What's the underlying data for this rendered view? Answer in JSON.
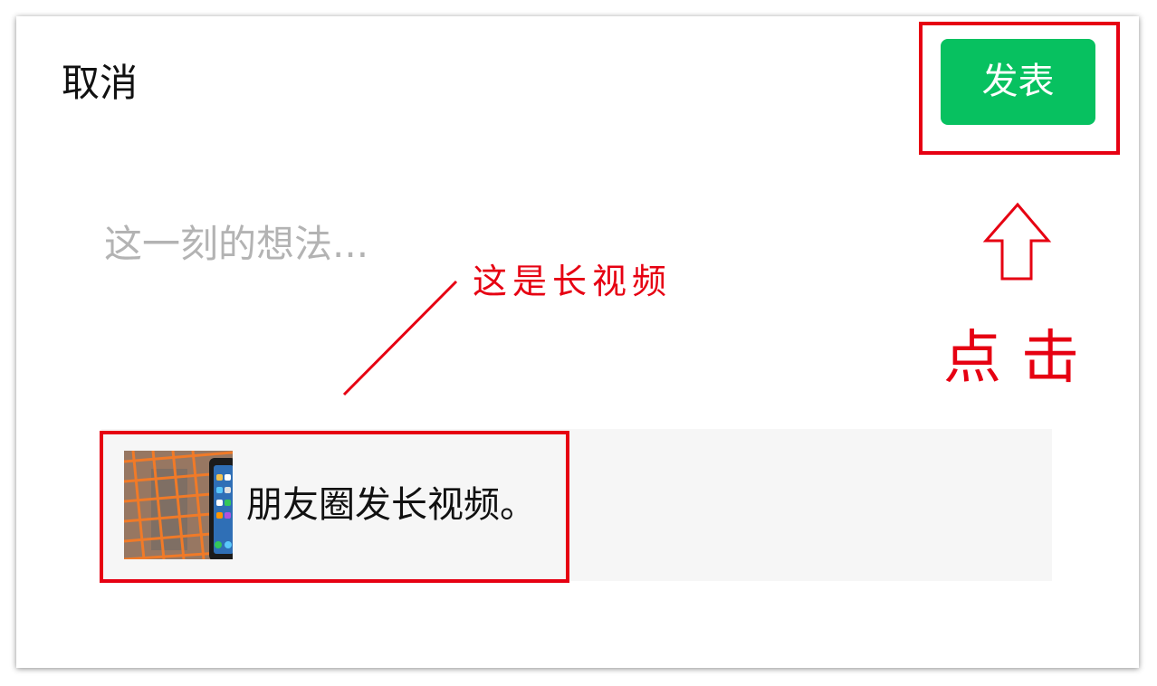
{
  "header": {
    "cancel_label": "取消",
    "publish_label": "发表"
  },
  "editor": {
    "placeholder": "这一刻的想法..."
  },
  "share_card": {
    "title": "朋友圈发长视频。"
  },
  "annotations": {
    "long_video_note": "这是长视频",
    "click_note": "点击",
    "color": "#e60012"
  },
  "colors": {
    "publish_button": "#07c160",
    "card_background": "#f6f6f6",
    "placeholder_text": "#b3b3b3"
  }
}
